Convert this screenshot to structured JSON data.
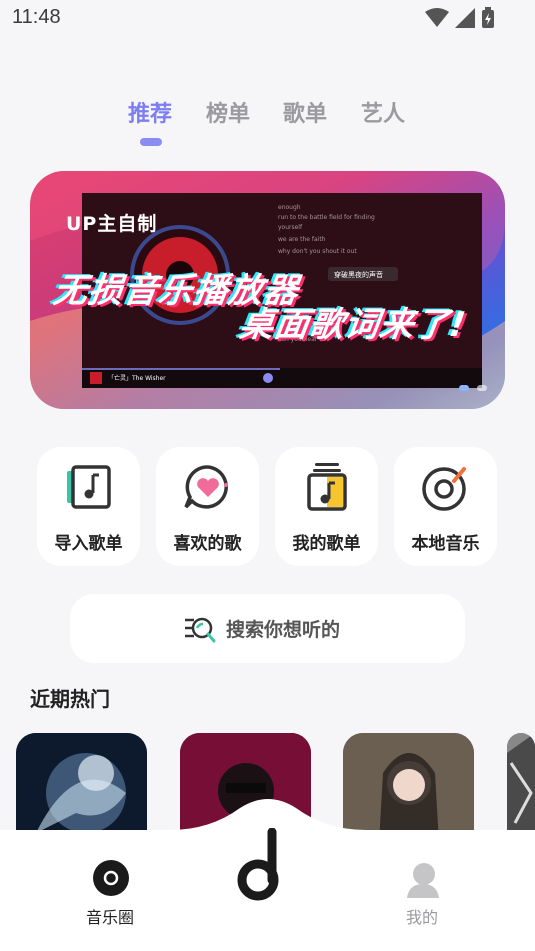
{
  "status_bar": {
    "time": "11:48",
    "icons": [
      "wifi-icon",
      "signal-icon",
      "battery-charging-icon"
    ]
  },
  "tabs": [
    {
      "label": "推荐",
      "active": true
    },
    {
      "label": "榜单",
      "active": false
    },
    {
      "label": "歌单",
      "active": false
    },
    {
      "label": "艺人",
      "active": false
    }
  ],
  "banner": {
    "badge": "UP主自制",
    "headline_1": "无损音乐播放器",
    "headline_2": "桌面歌词来了!",
    "lyrics": [
      "enough",
      "run to the battle field for finding",
      "yourself",
      "we are the faith",
      "why don't you shout it out",
      "穿破黑夜的声音",
      "在星空里的旋律",
      "can you hear us"
    ],
    "now_playing": "「亡灵」The Wisher",
    "slides_total": 2,
    "active_slide": 1
  },
  "quick_actions": [
    {
      "label": "导入歌单",
      "icon": "import-playlist-icon"
    },
    {
      "label": "喜欢的歌",
      "icon": "heart-chat-icon"
    },
    {
      "label": "我的歌单",
      "icon": "my-playlist-icon"
    },
    {
      "label": "本地音乐",
      "icon": "vinyl-disc-icon"
    }
  ],
  "search": {
    "placeholder": "搜索你想听的",
    "icon": "search-list-icon"
  },
  "section": {
    "title": "近期热门"
  },
  "bottom_nav": [
    {
      "label": "音乐圈",
      "icon": "music-circle-icon",
      "active": true
    },
    {
      "label": "",
      "icon": "app-logo-icon",
      "active": false
    },
    {
      "label": "我的",
      "icon": "profile-icon",
      "active": false
    }
  ],
  "colors": {
    "accent": "#7d7ef0",
    "inactive": "#9a9a9f",
    "background": "#f6f6f8"
  }
}
